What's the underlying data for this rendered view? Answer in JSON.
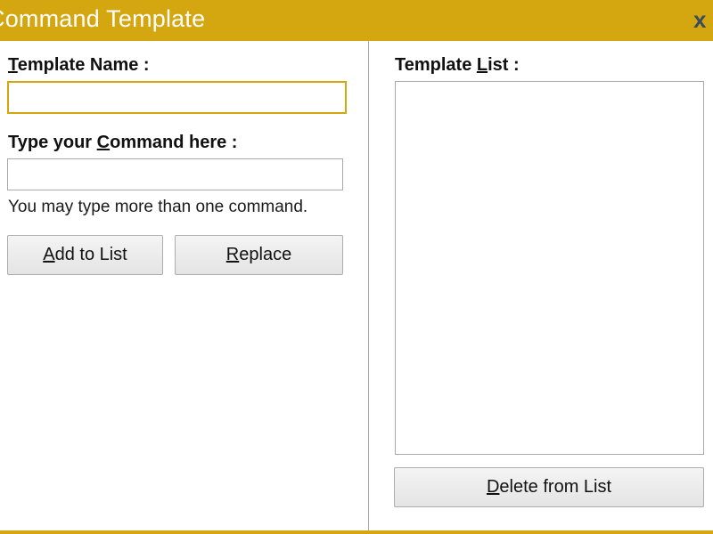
{
  "window": {
    "title": "Command Template",
    "close_glyph": "x",
    "accent_color": "#d4a60f"
  },
  "left_panel": {
    "template_name_label": "Template Name :",
    "template_name_value": "",
    "command_label": "Type your Command here :",
    "command_value": "",
    "hint": "You may type more than one command.",
    "add_button_label": "Add to List",
    "replace_button_label": "Replace"
  },
  "right_panel": {
    "list_label": "Template List :",
    "list_items": [],
    "delete_button_label": "Delete from List"
  },
  "icons": {
    "close": "close-icon"
  }
}
